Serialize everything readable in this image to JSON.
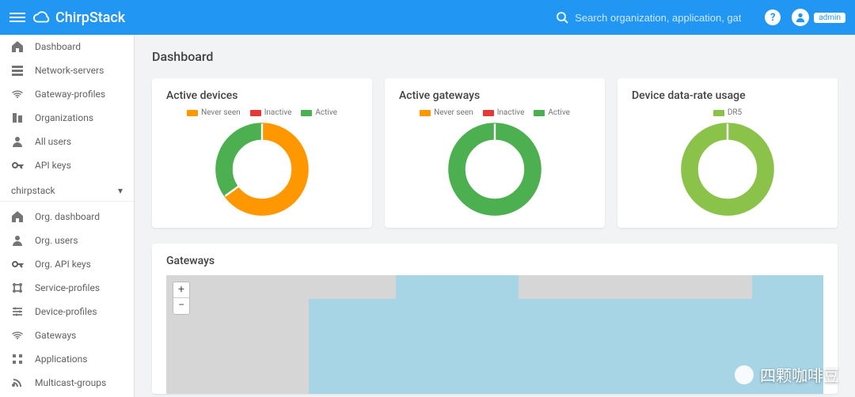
{
  "header": {
    "brand": "ChirpStack",
    "search_placeholder": "Search organization, application, gateway or device",
    "username": "admin"
  },
  "sidebar": {
    "top": [
      {
        "label": "Dashboard",
        "icon": "home"
      },
      {
        "label": "Network-servers",
        "icon": "servers"
      },
      {
        "label": "Gateway-profiles",
        "icon": "wifi"
      },
      {
        "label": "Organizations",
        "icon": "org"
      },
      {
        "label": "All users",
        "icon": "user"
      },
      {
        "label": "API keys",
        "icon": "key"
      }
    ],
    "org_selector": "chirpstack",
    "bottom": [
      {
        "label": "Org. dashboard",
        "icon": "home"
      },
      {
        "label": "Org. users",
        "icon": "user"
      },
      {
        "label": "Org. API keys",
        "icon": "key"
      },
      {
        "label": "Service-profiles",
        "icon": "service"
      },
      {
        "label": "Device-profiles",
        "icon": "sliders"
      },
      {
        "label": "Gateways",
        "icon": "wifi"
      },
      {
        "label": "Applications",
        "icon": "apps"
      },
      {
        "label": "Multicast-groups",
        "icon": "rss"
      }
    ]
  },
  "page": {
    "title": "Dashboard",
    "gateways_title": "Gateways"
  },
  "cards": [
    {
      "title": "Active devices",
      "legend": [
        {
          "label": "Never seen",
          "color": "#ff9800"
        },
        {
          "label": "Inactive",
          "color": "#e53935"
        },
        {
          "label": "Active",
          "color": "#4caf50"
        }
      ]
    },
    {
      "title": "Active gateways",
      "legend": [
        {
          "label": "Never seen",
          "color": "#ff9800"
        },
        {
          "label": "Inactive",
          "color": "#e53935"
        },
        {
          "label": "Active",
          "color": "#4caf50"
        }
      ]
    },
    {
      "title": "Device data-rate usage",
      "legend": [
        {
          "label": "DR5",
          "color": "#8bc34a"
        }
      ]
    }
  ],
  "chart_data": [
    {
      "type": "pie",
      "subtype": "donut",
      "title": "Active devices",
      "series": [
        {
          "name": "Never seen",
          "value": 65,
          "color": "#ff9800"
        },
        {
          "name": "Inactive",
          "value": 0,
          "color": "#e53935"
        },
        {
          "name": "Active",
          "value": 35,
          "color": "#4caf50"
        }
      ]
    },
    {
      "type": "pie",
      "subtype": "donut",
      "title": "Active gateways",
      "series": [
        {
          "name": "Never seen",
          "value": 0,
          "color": "#ff9800"
        },
        {
          "name": "Inactive",
          "value": 0,
          "color": "#e53935"
        },
        {
          "name": "Active",
          "value": 100,
          "color": "#4caf50"
        }
      ]
    },
    {
      "type": "pie",
      "subtype": "donut",
      "title": "Device data-rate usage",
      "series": [
        {
          "name": "DR5",
          "value": 100,
          "color": "#8bc34a"
        }
      ]
    }
  ],
  "watermark": "四颗咖啡豆"
}
